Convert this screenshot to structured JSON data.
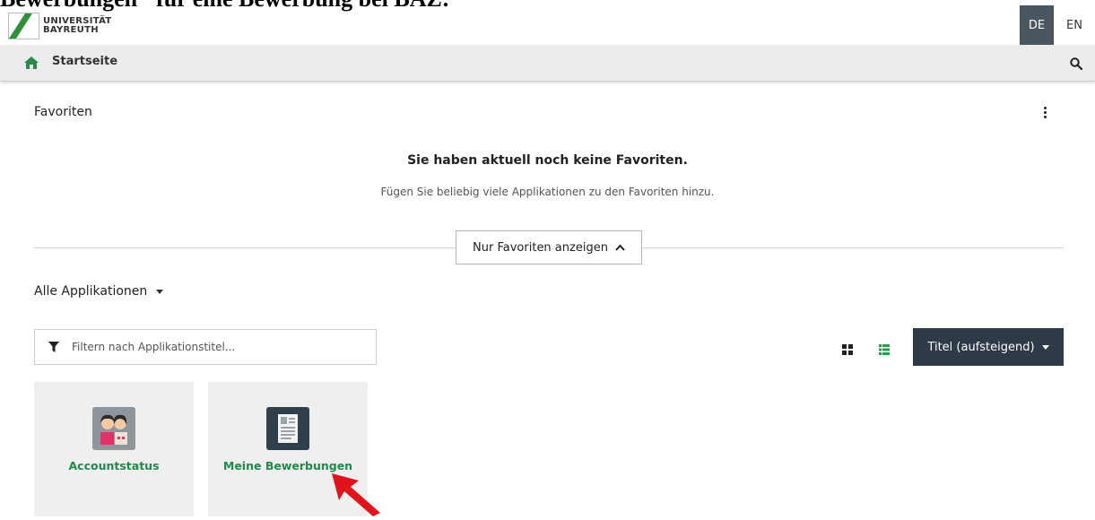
{
  "doc_heading": "Bewerbungen\" für eine Bewerbung bei BAZ:",
  "header": {
    "logo_line1": "UNIVERSITÄT",
    "logo_line2": "BAYREUTH",
    "lang_de": "DE",
    "lang_en": "EN",
    "lang_active_color": "#4a5660"
  },
  "nav": {
    "home_label": "Startseite",
    "home_icon": "home-icon",
    "search_icon": "search-icon"
  },
  "favorites": {
    "title": "Favoriten",
    "empty_title": "Sie haben aktuell noch keine Favoriten.",
    "empty_subtitle": "Fügen Sie beliebig viele Applikationen zu den Favoriten hinzu.",
    "toggle_label": "Nur Favoriten anzeigen"
  },
  "apps": {
    "section_title": "Alle Applikationen",
    "filter_placeholder": "Filtern nach Applikationstitel...",
    "sort_label": "Titel (aufsteigend)",
    "sort_color": "#2e3b47",
    "link_color": "#1f8a4c",
    "tiles": [
      {
        "label": "Accountstatus",
        "icon": "accountstatus-icon"
      },
      {
        "label": "Meine Bewerbungen",
        "icon": "document-icon"
      }
    ]
  },
  "annotation": {
    "arrow_color": "#e0151b"
  }
}
